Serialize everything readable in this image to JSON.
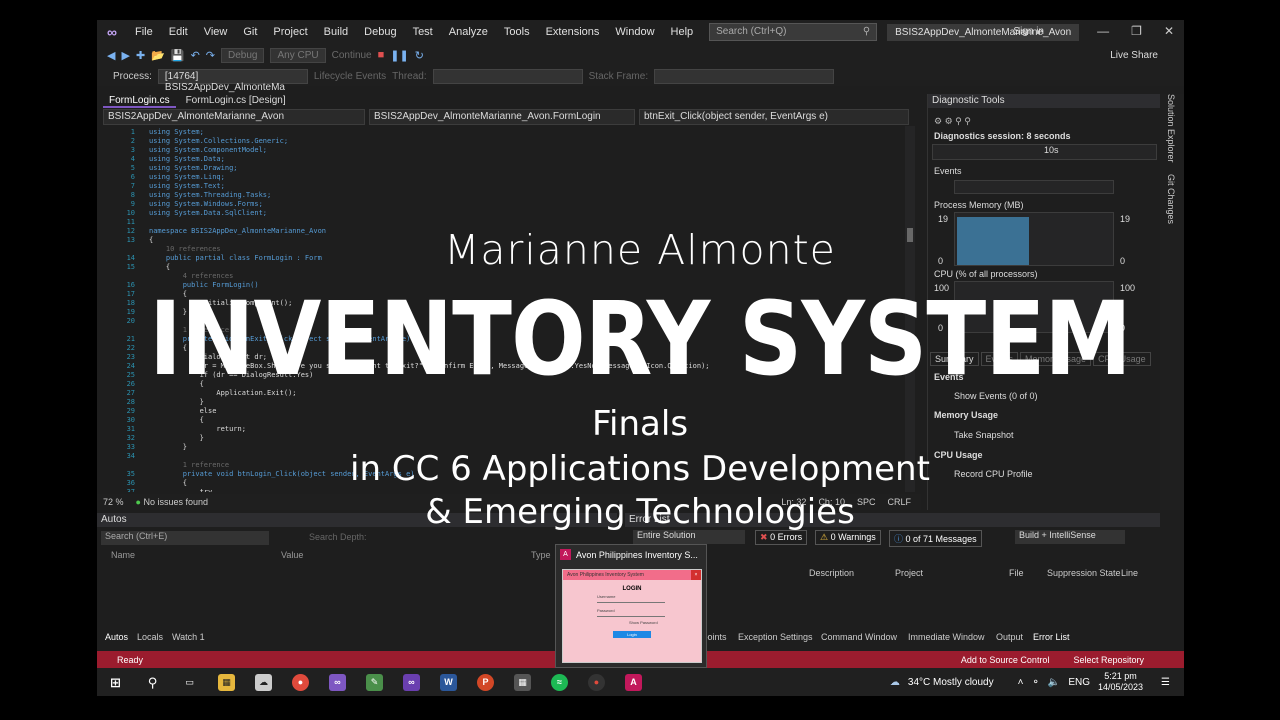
{
  "menubar": {
    "items": [
      "File",
      "Edit",
      "View",
      "Git",
      "Project",
      "Build",
      "Debug",
      "Test",
      "Analyze",
      "Tools",
      "Extensions",
      "Window",
      "Help"
    ],
    "search_placeholder": "Search (Ctrl+Q)",
    "solution_name": "BSIS2AppDev_AlmonteMarianne_Avon",
    "signin": "Sign in",
    "live_share": "Live Share"
  },
  "toolbar": {
    "config": "Debug",
    "platform": "Any CPU",
    "continue": "Continue",
    "process_label": "Process:",
    "process_value": "[14764] BSIS2AppDev_AlmonteMa",
    "lifecycle": "Lifecycle Events",
    "thread": "Thread:",
    "stack_frame": "Stack Frame:"
  },
  "doc_tabs": [
    "FormLogin.cs",
    "FormLogin.cs [Design]"
  ],
  "nav_bar": [
    "BSIS2AppDev_AlmonteMarianne_Avon",
    "BSIS2AppDev_AlmonteMarianne_Avon.FormLogin",
    "btnExit_Click(object sender, EventArgs e)"
  ],
  "code_lines": [
    {
      "n": "1",
      "t": "using System;"
    },
    {
      "n": "2",
      "t": "using System.Collections.Generic;"
    },
    {
      "n": "3",
      "t": "using System.ComponentModel;"
    },
    {
      "n": "4",
      "t": "using System.Data;"
    },
    {
      "n": "5",
      "t": "using System.Drawing;"
    },
    {
      "n": "6",
      "t": "using System.Linq;"
    },
    {
      "n": "7",
      "t": "using System.Text;"
    },
    {
      "n": "8",
      "t": "using System.Threading.Tasks;"
    },
    {
      "n": "9",
      "t": "using System.Windows.Forms;"
    },
    {
      "n": "10",
      "t": "using System.Data.SqlClient;"
    },
    {
      "n": "11",
      "t": ""
    },
    {
      "n": "12",
      "t": "namespace BSIS2AppDev_AlmonteMarianne_Avon"
    },
    {
      "n": "13",
      "t": "{"
    },
    {
      "n": "",
      "t": "    10 references"
    },
    {
      "n": "14",
      "t": "    public partial class FormLogin : Form"
    },
    {
      "n": "15",
      "t": "    {"
    },
    {
      "n": "",
      "t": "        4 references"
    },
    {
      "n": "16",
      "t": "        public FormLogin()"
    },
    {
      "n": "17",
      "t": "        {"
    },
    {
      "n": "18",
      "t": "            InitializeComponent();"
    },
    {
      "n": "19",
      "t": "        }"
    },
    {
      "n": "20",
      "t": ""
    },
    {
      "n": "",
      "t": "        1 reference"
    },
    {
      "n": "21",
      "t": "        private void btnExit_Click(object sender, EventArgs e)"
    },
    {
      "n": "22",
      "t": "        {"
    },
    {
      "n": "23",
      "t": "            DialogResult dr;"
    },
    {
      "n": "24",
      "t": "            dr = MessageBox.Show(\"Are you sure you want to exit?\", \"Confirm Exit\", MessageBoxButtons.YesNo, MessageBoxIcon.Question);"
    },
    {
      "n": "25",
      "t": "            if (dr == DialogResult.Yes)"
    },
    {
      "n": "26",
      "t": "            {"
    },
    {
      "n": "27",
      "t": "                Application.Exit();"
    },
    {
      "n": "28",
      "t": "            }"
    },
    {
      "n": "29",
      "t": "            else"
    },
    {
      "n": "30",
      "t": "            {"
    },
    {
      "n": "31",
      "t": "                return;"
    },
    {
      "n": "32",
      "t": "            }"
    },
    {
      "n": "33",
      "t": "        }"
    },
    {
      "n": "34",
      "t": ""
    },
    {
      "n": "",
      "t": "        1 reference"
    },
    {
      "n": "35",
      "t": "        private void btnLogin_Click(object sender, EventArgs e)"
    },
    {
      "n": "36",
      "t": "        {"
    },
    {
      "n": "37",
      "t": "            try"
    }
  ],
  "editor_status": {
    "zoom": "72 %",
    "issues": "No issues found",
    "ln": "Ln: 32",
    "ch": "Ch: 10",
    "spc": "SPC",
    "crlf": "CRLF"
  },
  "diagnostics": {
    "title": "Diagnostic Tools",
    "session": "Diagnostics session: 8 seconds",
    "timeline_tick": "10s",
    "events": "Events",
    "process_memory": "Process Memory (MB)",
    "mem_max": "19",
    "mem_min": "0",
    "cpu": "CPU (% of all processors)",
    "cpu_max": "100",
    "cpu_min": "0",
    "tabs": [
      "Summary",
      "Events",
      "Memory Usage",
      "CPU Usage"
    ],
    "events_section": "Events",
    "show_events": "Show Events (0 of 0)",
    "memory_usage": "Memory Usage",
    "take_snapshot": "Take Snapshot",
    "cpu_usage": "CPU Usage",
    "record_cpu": "Record CPU Profile",
    "memory_fill": 0.95
  },
  "side_tabs": [
    "Solution Explorer",
    "Git Changes"
  ],
  "autos": {
    "title": "Autos",
    "search": "Search (Ctrl+E)",
    "search_depth": "Search Depth:",
    "cols": [
      "Name",
      "Value",
      "Type"
    ]
  },
  "errlist": {
    "title": "Error List",
    "scope": "Entire Solution",
    "errors": "0 Errors",
    "warnings": "0 Warnings",
    "messages": "0 of 71 Messages",
    "build": "Build + IntelliSense",
    "cols": [
      "Description",
      "Project",
      "File",
      "Line",
      "Suppression State"
    ]
  },
  "bottom_tabs_left": [
    "Autos",
    "Locals",
    "Watch 1"
  ],
  "bottom_tabs_right": [
    "Breakpoints",
    "Exception Settings",
    "Command Window",
    "Immediate Window",
    "Output",
    "Error List"
  ],
  "statusbar": {
    "ready": "Ready",
    "add_source": "Add to Source Control",
    "select_repo": "Select Repository"
  },
  "popup": {
    "title": "Avon Philippines Inventory S...",
    "form_title": "Avon Philippines Inventory System",
    "login": "LOGIN",
    "username": "Username",
    "password": "Password",
    "show_password": "Show Password",
    "login_btn": "Login"
  },
  "taskbar": {
    "weather": "34°C  Mostly cloudy",
    "lang": "ENG",
    "time": "5:21 pm",
    "date": "14/05/2023"
  },
  "overlay": {
    "name": "Marianne Almonte",
    "title": "INVENTORY SYSTEM",
    "subtitle": "Finals",
    "course_line1": "in CC 6 Applications Development",
    "course_line2": "& Emerging Technologies"
  }
}
